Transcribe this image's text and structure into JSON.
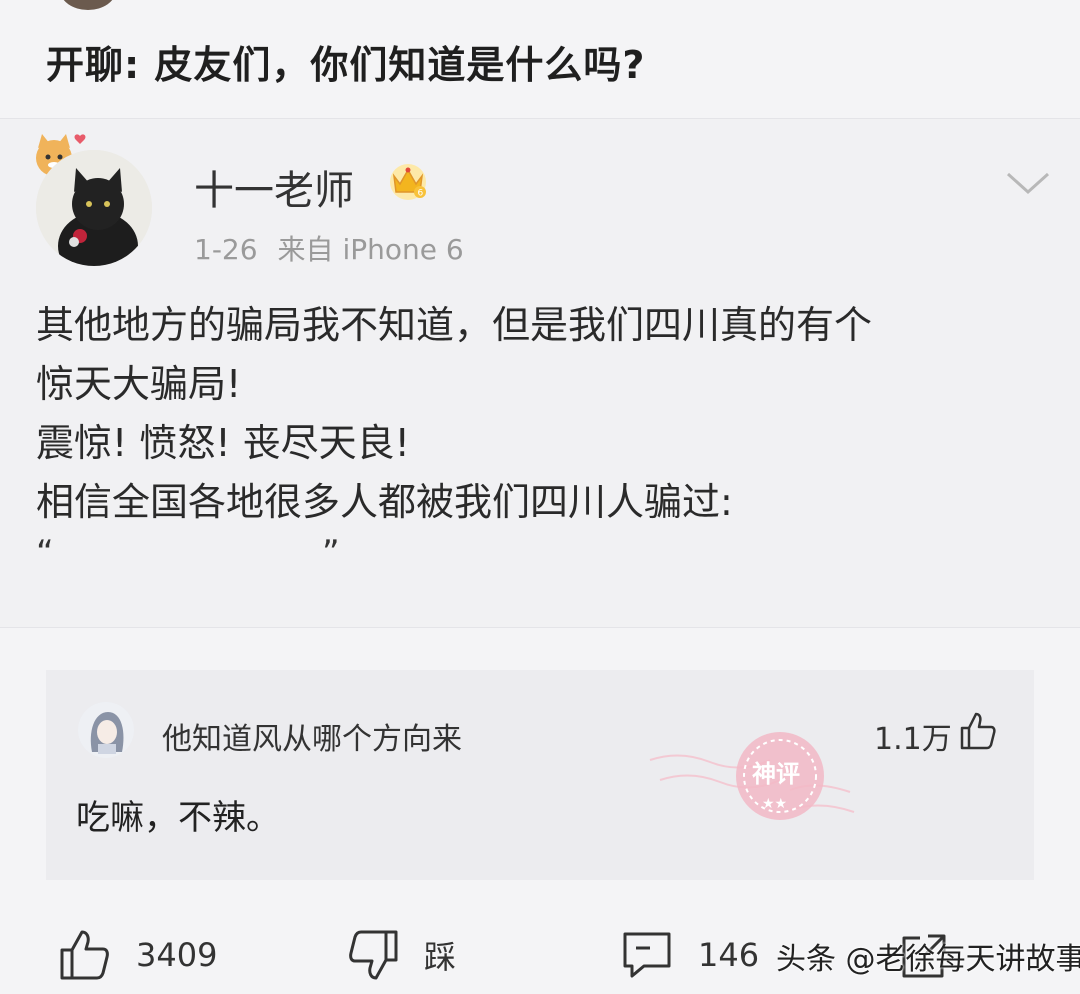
{
  "topic": {
    "title": "开聊: 皮友们，你们知道是什么吗?"
  },
  "post": {
    "username": "十一老师",
    "date": "1-26",
    "source": "来自 iPhone 6",
    "lines": [
      "其他地方的骗局我不知道，但是我们四川真的有个",
      "惊天大骗局!",
      "震惊! 愤怒! 丧尽天良!",
      "相信全国各地很多人都被我们四川人骗过:"
    ],
    "quote_open": "“",
    "quote_close": "”"
  },
  "comment": {
    "username": "他知道风从哪个方向来",
    "likes": "1.1万",
    "text": "吃嘛，不辣。",
    "stamp_label": "神评"
  },
  "actions": {
    "like_count": "3409",
    "dislike_label": "踩",
    "comment_count": "146"
  },
  "watermark": "头条 @老徐每天讲故事",
  "colors": {
    "background": "#f4f4f6",
    "card": "#f1f1f3",
    "comment_box": "#ececef",
    "stamp": "#f2b8c6"
  },
  "icons": {
    "badge": "vip-crown-icon",
    "menu": "chevron-down-icon",
    "like": "thumbs-up-icon",
    "dislike": "thumbs-down-icon",
    "comment": "comment-bubble-icon",
    "share": "share-icon"
  }
}
